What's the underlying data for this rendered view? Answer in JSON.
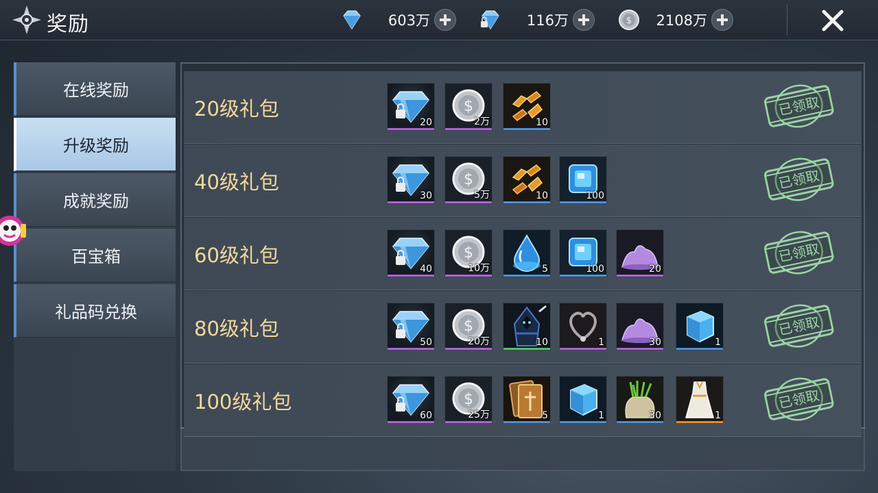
{
  "header": {
    "title": "奖励",
    "currencies": [
      {
        "icon": "diamond-icon",
        "amount": "603万"
      },
      {
        "icon": "bound-diamond-icon",
        "amount": "116万"
      },
      {
        "icon": "silver-coin-icon",
        "amount": "2108万"
      }
    ]
  },
  "sidebar": {
    "items": [
      {
        "label": "在线奖励",
        "active": false
      },
      {
        "label": "升级奖励",
        "active": true
      },
      {
        "label": "成就奖励",
        "active": false
      },
      {
        "label": "百宝箱",
        "active": false
      },
      {
        "label": "礼品码兑换",
        "active": false
      }
    ]
  },
  "colors": {
    "rarity_purple": "#b060d8",
    "rarity_blue": "#4a90d8",
    "rarity_green": "#4cc45a",
    "rarity_orange": "#e88a2a",
    "label_gold": "#f3d89a",
    "stamp_green": "#9cd4a4"
  },
  "packs": [
    {
      "label": "20级礼包",
      "status": "已领取",
      "items": [
        {
          "icon": "bound-diamond-icon",
          "count": "20",
          "rarity": "purple"
        },
        {
          "icon": "silver-coin-icon",
          "count": "2万",
          "rarity": "purple"
        },
        {
          "icon": "gold-shards-icon",
          "count": "10",
          "rarity": "blue"
        }
      ]
    },
    {
      "label": "40级礼包",
      "status": "已领取",
      "items": [
        {
          "icon": "bound-diamond-icon",
          "count": "30",
          "rarity": "purple"
        },
        {
          "icon": "silver-coin-icon",
          "count": "5万",
          "rarity": "purple"
        },
        {
          "icon": "gold-shards-icon",
          "count": "10",
          "rarity": "blue"
        },
        {
          "icon": "blue-gem-icon",
          "count": "100",
          "rarity": "blue"
        }
      ]
    },
    {
      "label": "60级礼包",
      "status": "已领取",
      "items": [
        {
          "icon": "bound-diamond-icon",
          "count": "40",
          "rarity": "purple"
        },
        {
          "icon": "silver-coin-icon",
          "count": "10万",
          "rarity": "purple"
        },
        {
          "icon": "water-drop-icon",
          "count": "5",
          "rarity": "blue"
        },
        {
          "icon": "blue-gem-icon",
          "count": "100",
          "rarity": "blue"
        },
        {
          "icon": "purple-powder-icon",
          "count": "20",
          "rarity": "purple"
        }
      ]
    },
    {
      "label": "80级礼包",
      "status": "已领取",
      "items": [
        {
          "icon": "bound-diamond-icon",
          "count": "50",
          "rarity": "purple"
        },
        {
          "icon": "silver-coin-icon",
          "count": "20万",
          "rarity": "purple"
        },
        {
          "icon": "hooded-figure-icon",
          "count": "10",
          "rarity": "green"
        },
        {
          "icon": "heart-necklace-icon",
          "count": "1",
          "rarity": "purple"
        },
        {
          "icon": "purple-powder-icon",
          "count": "30",
          "rarity": "purple"
        },
        {
          "icon": "ice-cube-icon",
          "count": "1",
          "rarity": "blue"
        }
      ]
    },
    {
      "label": "100级礼包",
      "status": "已领取",
      "items": [
        {
          "icon": "bound-diamond-icon",
          "count": "60",
          "rarity": "purple"
        },
        {
          "icon": "silver-coin-icon",
          "count": "25万",
          "rarity": "purple"
        },
        {
          "icon": "card-icon",
          "count": "5",
          "rarity": "blue"
        },
        {
          "icon": "ice-cube-icon",
          "count": "1",
          "rarity": "blue"
        },
        {
          "icon": "herb-sack-icon",
          "count": "30",
          "rarity": "blue"
        },
        {
          "icon": "white-dress-icon",
          "count": "1",
          "rarity": "orange"
        }
      ]
    }
  ]
}
